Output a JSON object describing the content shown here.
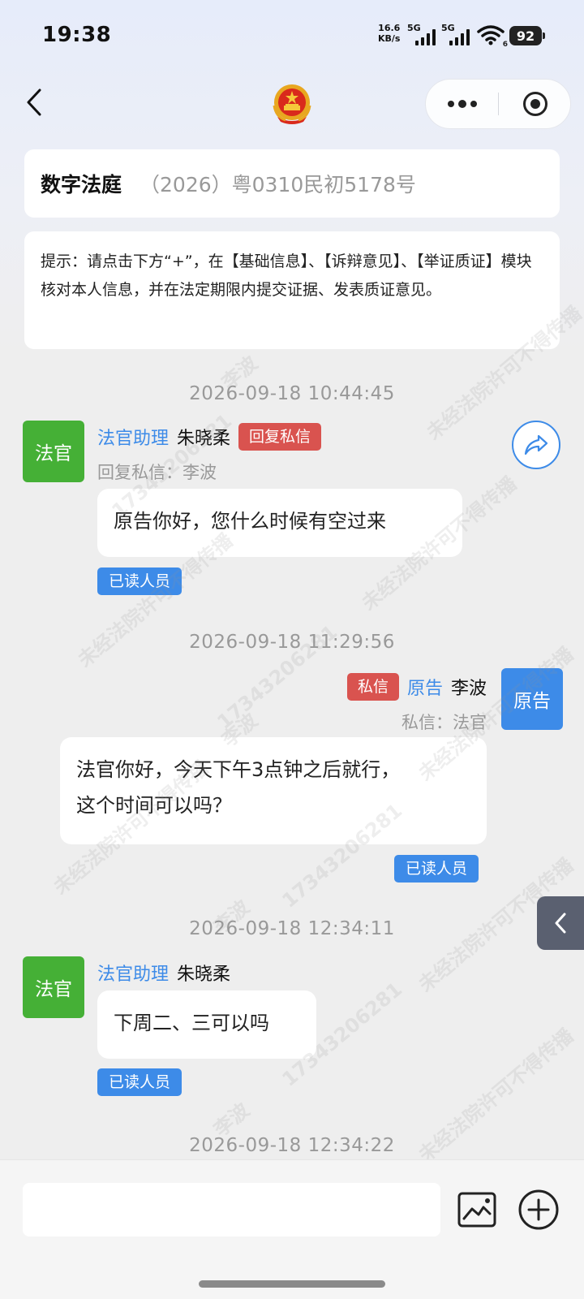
{
  "status_bar": {
    "time": "19:38",
    "net_speed_value": "16.6",
    "net_speed_unit": "KB/s",
    "sim1": "5G",
    "sim2": "5G",
    "wifi_sub": "6",
    "battery": "92"
  },
  "icons": {
    "back": "chevron-left-icon",
    "emblem": "national-emblem-icon",
    "more": "more-dots-icon",
    "close": "target-close-icon",
    "share": "share-forward-icon",
    "side": "chevron-left-icon",
    "image": "image-icon",
    "add": "plus-circle-icon"
  },
  "header": {
    "title": "数字法庭",
    "case_number": "（2026）粤0310民初5178号"
  },
  "tip": {
    "text": "提示：请点击下方“+”，在【基础信息】、【诉辩意见】、【举证质证】模块核对本人信息，并在法定期限内提交证据、发表质证意见。"
  },
  "messages": [
    {
      "timestamp": "2026-09-18 10:44:45",
      "avatar_label": "法官",
      "role": "法官助理",
      "name": "朱晓柔",
      "tag": "回复私信",
      "sub": "回复私信：李波",
      "text": "原告你好，您什么时候有空过来",
      "read_label": "已读人员"
    },
    {
      "timestamp": "2026-09-18 11:29:56",
      "avatar_label": "原告",
      "role": "原告",
      "name": "李波",
      "tag": "私信",
      "sub": "私信：法官",
      "text_line1": "法官你好，今天下午3点钟之后就行，",
      "text_line2": "这个时间可以吗？",
      "read_label": "已读人员"
    },
    {
      "timestamp": "2026-09-18 12:34:11",
      "avatar_label": "法官",
      "role": "法官助理",
      "name": "朱晓柔",
      "text": "下周二、三可以吗",
      "read_label": "已读人员"
    },
    {
      "timestamp": "2026-09-18 12:34:22"
    }
  ],
  "watermark": {
    "text_a": "未经法院许可不得传播",
    "text_b": "17343206281",
    "text_c": "李波"
  },
  "input": {
    "placeholder": ""
  },
  "colors": {
    "accent_blue": "#3d8be8",
    "judge_green": "#45b036",
    "tag_red": "#d9534f"
  }
}
